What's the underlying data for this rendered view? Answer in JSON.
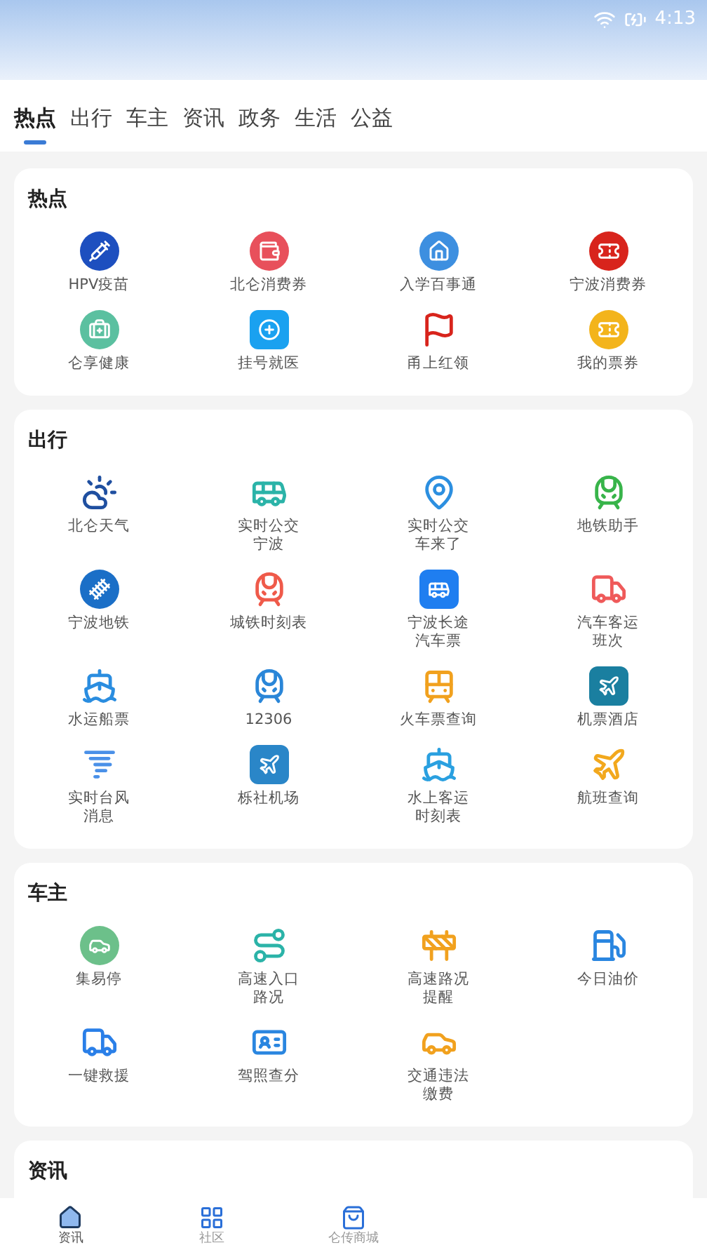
{
  "status_bar": {
    "time": "4:13"
  },
  "tabs": [
    {
      "label": "热点",
      "selected": true
    },
    {
      "label": "出行",
      "selected": false
    },
    {
      "label": "车主",
      "selected": false
    },
    {
      "label": "资讯",
      "selected": false
    },
    {
      "label": "政务",
      "selected": false
    },
    {
      "label": "生活",
      "selected": false
    },
    {
      "label": "公益",
      "selected": false
    }
  ],
  "sections": [
    {
      "title": "热点",
      "items": [
        "HPV疫苗",
        "北仑消费券",
        "入学百事通",
        "宁波消费券",
        "仑享健康",
        "挂号就医",
        "甬上红领",
        "我的票券"
      ]
    },
    {
      "title": "出行",
      "items": [
        "北仑天气",
        "实时公交宁波",
        "实时公交车来了",
        "地铁助手",
        "宁波地铁",
        "城铁时刻表",
        "宁波长途汽车票",
        "汽车客运班次",
        "水运船票",
        "12306",
        "火车票查询",
        "机票酒店",
        "实时台风消息",
        "栎社机场",
        "水上客运时刻表",
        "航班查询"
      ]
    },
    {
      "title": "车主",
      "items": [
        "集易停",
        "高速入口路况",
        "高速路况提醒",
        "今日油价",
        "一键救援",
        "驾照查分",
        "交通违法缴费"
      ]
    },
    {
      "title": "资讯"
    }
  ],
  "bottom_nav": [
    {
      "label": "资讯",
      "selected": true
    },
    {
      "label": "社区",
      "selected": false
    },
    {
      "label": "仑传商城",
      "selected": false
    }
  ]
}
